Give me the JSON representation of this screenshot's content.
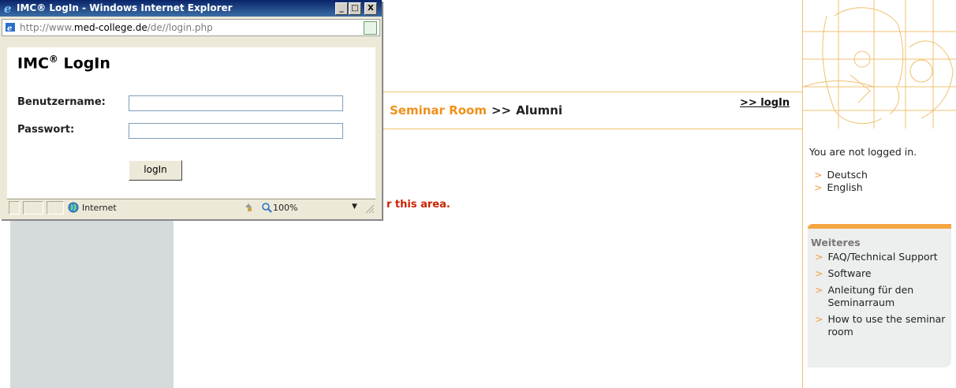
{
  "browser": {
    "window_title": "IMC® LogIn - Windows Internet Explorer",
    "controls": {
      "minimize": "_",
      "maximize": "□",
      "close": "X"
    },
    "address": {
      "url_prefix": "http://www.",
      "url_domain": "med-college.de",
      "url_rest": "/de//login.php"
    },
    "status": {
      "zone": "Internet",
      "zoom": "100%"
    },
    "icons": [
      "ie-logo-icon",
      "page-icon",
      "rss-feed-icon",
      "globe-icon",
      "protected-mode-icon",
      "zoom-icon",
      "chevron-down-icon",
      "resize-grip-icon"
    ]
  },
  "login_form": {
    "heading_main": "IMC",
    "heading_sup": "®",
    "heading_rest": " LogIn",
    "username_label": "Benutzername:",
    "username_value": "",
    "password_label": "Passwort:",
    "password_value": "",
    "submit_label": "logIn"
  },
  "page": {
    "breadcrumb": {
      "seminar": "Seminar Room",
      "separator": ">>",
      "current": "Alumni"
    },
    "login_link": ">> logIn",
    "error_fragment": "r this area.",
    "status_text": "You are not logged in.",
    "languages": [
      "Deutsch",
      "English"
    ],
    "more": {
      "heading": "Weiteres",
      "items": [
        "FAQ/Technical Support",
        "Software",
        "Anleitung für den Seminarraum",
        "How to use the seminar room"
      ]
    },
    "arrow_glyph": ">",
    "colors": {
      "accent": "#f0901a",
      "error": "#cc2200",
      "sidebar_gray": "#d5dadb"
    }
  }
}
